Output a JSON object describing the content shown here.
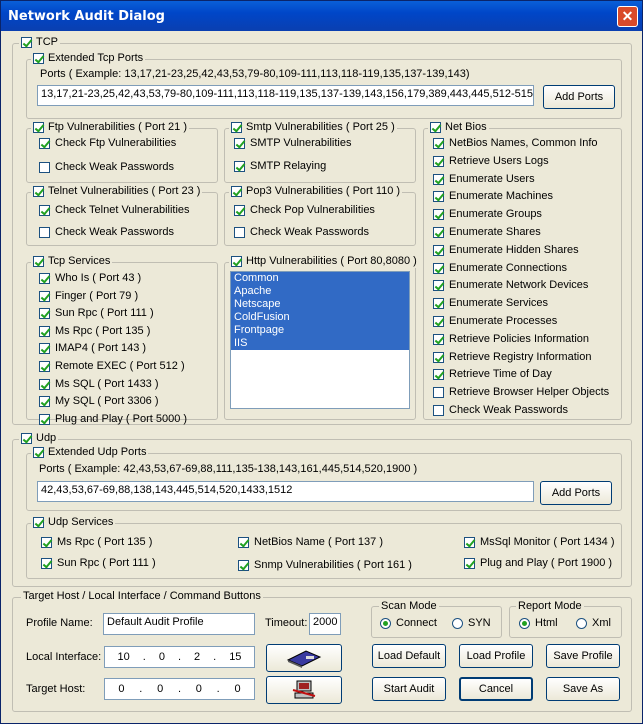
{
  "title": "Network Audit Dialog",
  "tcp": {
    "label": "TCP",
    "extended": {
      "label": "Extended Tcp Ports",
      "example": "Ports ( Example: 13,17,21-23,25,42,43,53,79-80,109-111,113,118-119,135,137-139,143)",
      "value": "13,17,21-23,25,42,43,53,79-80,109-111,113,118-119,135,137-139,143,156,179,389,443,445,512-515,5",
      "add_button": "Add Ports"
    },
    "ftp": {
      "label": "Ftp Vulnerabilities ( Port 21 )",
      "items": [
        "Check Ftp Vulnerabilities",
        "Check Weak Passwords"
      ]
    },
    "smtp": {
      "label": "Smtp Vulnerabilities ( Port 25 )",
      "items": [
        "SMTP Vulnerabilities",
        "SMTP  Relaying"
      ]
    },
    "telnet": {
      "label": "Telnet Vulnerabilities ( Port 23 )",
      "items": [
        "Check Telnet Vulnerabilities",
        "Check Weak Passwords"
      ]
    },
    "pop3": {
      "label": "Pop3 Vulnerabilities ( Port 110 )",
      "items": [
        "Check Pop Vulnerabilities",
        "Check Weak Passwords"
      ]
    },
    "services": {
      "label": "Tcp Services",
      "items": [
        "Who Is ( Port 43 )",
        "Finger ( Port 79 )",
        "Sun Rpc ( Port 111 )",
        "Ms Rpc ( Port 135 )",
        "IMAP4 ( Port 143 )",
        "Remote EXEC ( Port 512 )",
        "Ms SQL ( Port 1433 )",
        "My SQL ( Port 3306 )",
        "Plug and Play  ( Port 5000 )"
      ]
    },
    "http": {
      "label": "Http Vulnerabilities ( Port 80,8080 )",
      "items": [
        "Common",
        "Apache",
        "Netscape",
        "ColdFusion",
        "Frontpage",
        "IIS"
      ]
    },
    "netbios": {
      "label": "Net Bios",
      "items": [
        "NetBios Names, Common  Info",
        "Retrieve Users Logs",
        "Enumerate Users",
        "Enumerate Machines",
        "Enumerate Groups",
        "Enumerate Shares",
        "Enumerate Hidden Shares",
        "Enumerate Connections",
        "Enumerate Network Devices",
        "Enumerate Services",
        "Enumerate Processes",
        "Retrieve Policies Information",
        "Retrieve Registry Information",
        "Retrieve Time of Day",
        "Retrieve Browser Helper Objects",
        "Check Weak Passwords"
      ]
    }
  },
  "udp": {
    "label": "Udp",
    "extended": {
      "label": "Extended Udp Ports",
      "example": "Ports ( Example: 42,43,53,67-69,88,111,135-138,143,161,445,514,520,1900 )",
      "value": "42,43,53,67-69,88,138,143,445,514,520,1433,1512",
      "add_button": "Add Ports"
    },
    "services": {
      "label": "Udp Services",
      "items": [
        "Ms Rpc ( Port 135 )",
        "Sun Rpc ( Port 111 )",
        "NetBios Name ( Port 137 )",
        "Snmp Vulnerabilities ( Port 161 )",
        "MsSql Monitor ( Port 1434 )",
        "Plug and Play  ( Port 1900 )"
      ]
    }
  },
  "target": {
    "label": "Target Host / Local Interface / Command Buttons",
    "profile_label": "Profile Name:",
    "profile_value": "Default Audit Profile",
    "timeout_label": "Timeout:",
    "timeout_value": "2000",
    "local_label": "Local Interface:",
    "local_ip": [
      "10",
      "0",
      "2",
      "15"
    ],
    "host_label": "Target Host:",
    "host_ip": [
      "0",
      "0",
      "0",
      "0"
    ],
    "scan_mode": {
      "label": "Scan Mode",
      "options": [
        "Connect",
        "SYN"
      ]
    },
    "report_mode": {
      "label": "Report Mode",
      "options": [
        "Html",
        "Xml"
      ]
    },
    "buttons": {
      "load_default": "Load Default",
      "load_profile": "Load Profile",
      "save_profile": "Save Profile",
      "start_audit": "Start Audit",
      "cancel": "Cancel",
      "save_as": "Save As"
    }
  }
}
